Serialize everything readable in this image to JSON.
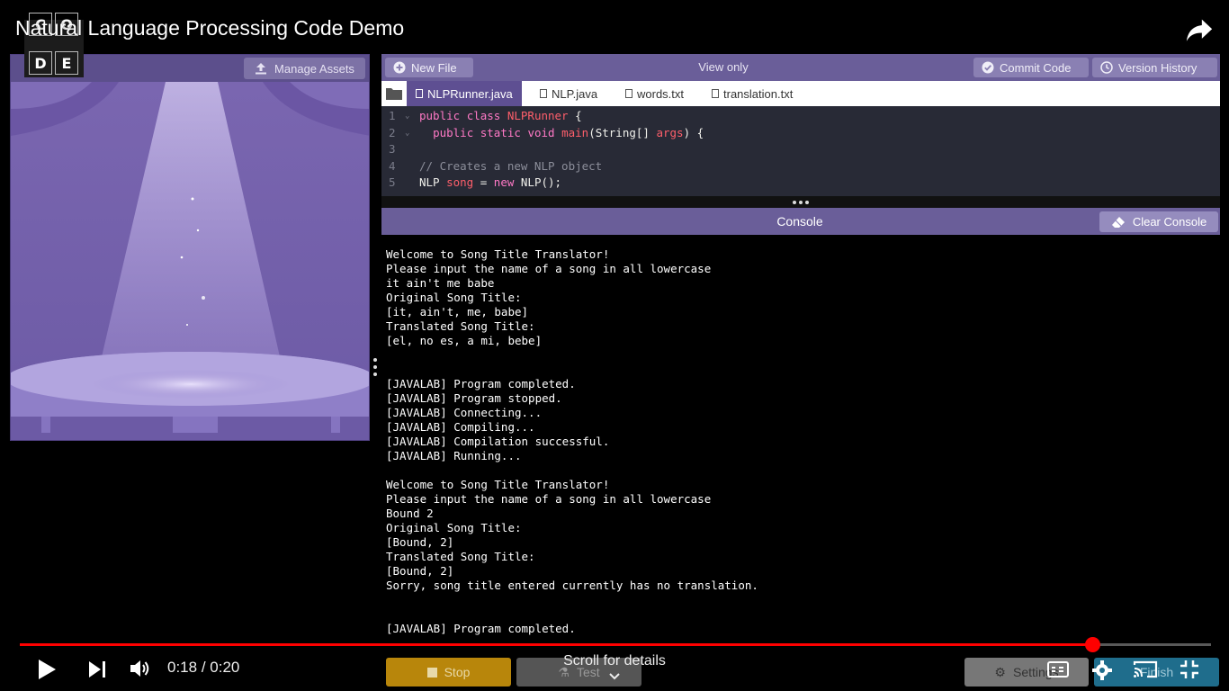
{
  "video": {
    "title": "Natural Language Processing Code Demo",
    "time_current": "0:18",
    "time_separator": "/",
    "time_total": "0:20",
    "progress_fraction": 0.9,
    "scroll_hint": "Scroll for details"
  },
  "logo": {
    "letters": [
      "C",
      "O",
      "D",
      "E"
    ]
  },
  "preview": {
    "manage_assets_label": "Manage Assets"
  },
  "editor": {
    "new_file_label": "New File",
    "view_only_label": "View only",
    "commit_label": "Commit Code",
    "history_label": "Version History",
    "tabs": [
      {
        "label": "NLPRunner.java",
        "active": true
      },
      {
        "label": "NLP.java",
        "active": false
      },
      {
        "label": "words.txt",
        "active": false
      },
      {
        "label": "translation.txt",
        "active": false
      }
    ],
    "lines": [
      {
        "num": "1",
        "fold": "⌄",
        "tokens": [
          [
            "kw",
            "public "
          ],
          [
            "kw",
            "class "
          ],
          [
            "cls",
            "NLPRunner"
          ],
          [
            "pl",
            " {"
          ]
        ]
      },
      {
        "num": "2",
        "fold": "⌄",
        "tokens": [
          [
            "pl",
            "  "
          ],
          [
            "kw",
            "public "
          ],
          [
            "kw",
            "static "
          ],
          [
            "kw",
            "void "
          ],
          [
            "cls",
            "main"
          ],
          [
            "pl",
            "(String[] "
          ],
          [
            "cls",
            "args"
          ],
          [
            "pl",
            ") {"
          ]
        ]
      },
      {
        "num": "3",
        "fold": "",
        "tokens": []
      },
      {
        "num": "4",
        "fold": "",
        "tokens": [
          [
            "cm",
            "// Creates a new NLP object"
          ]
        ]
      },
      {
        "num": "5",
        "fold": "",
        "tokens": [
          [
            "pl",
            "NLP "
          ],
          [
            "cls",
            "song"
          ],
          [
            "pl",
            " = "
          ],
          [
            "kw",
            "new "
          ],
          [
            "pl",
            "NLP();"
          ]
        ]
      }
    ]
  },
  "console": {
    "title": "Console",
    "clear_label": "Clear Console",
    "lines": [
      "Welcome to Song Title Translator!",
      "Please input the name of a song in all lowercase",
      "it ain't me babe",
      "Original Song Title:",
      "[it, ain't, me, babe]",
      "Translated Song Title:",
      "[el, no es, a mi, bebe]",
      "",
      "",
      "[JAVALAB] Program completed.",
      "[JAVALAB] Program stopped.",
      "[JAVALAB] Connecting...",
      "[JAVALAB] Compiling...",
      "[JAVALAB] Compilation successful.",
      "[JAVALAB] Running...",
      "",
      "Welcome to Song Title Translator!",
      "Please input the name of a song in all lowercase",
      "Bound 2",
      "Original Song Title:",
      "[Bound, 2]",
      "Translated Song Title:",
      "[Bound, 2]",
      "Sorry, song title entered currently has no translation.",
      "",
      "",
      "[JAVALAB] Program completed."
    ]
  },
  "run_controls": {
    "stop_label": "Stop",
    "test_label": "Test",
    "settings_label": "Settings",
    "finish_label": "Finish"
  },
  "colors": {
    "accent_purple": "#6a5e99",
    "progress_red": "#ff0000",
    "stop_orange": "#b8860b"
  }
}
